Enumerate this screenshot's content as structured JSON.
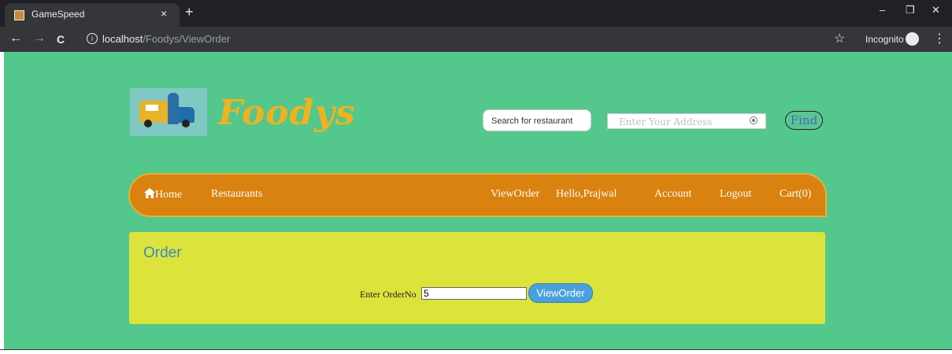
{
  "browser": {
    "tab_title": "GameSpeed",
    "tab_close": "×",
    "new_tab": "+",
    "url_host": "localhost",
    "url_path": "/Foodys/ViewOrder",
    "incognito_label": "Incognito",
    "minimize": "–",
    "restore": "❐",
    "close": "✕",
    "back": "←",
    "forward": "→",
    "reload": "C",
    "star": "☆",
    "menu": "⋮"
  },
  "header": {
    "brand": "Foodys",
    "search_placeholder": "Search for restaurant",
    "address_placeholder": "Enter Your Address",
    "find_label": "Find"
  },
  "nav": {
    "home": "Home",
    "restaurants": "Restaurants",
    "view_order": "ViewOrder",
    "greeting": "Hello,Prajwal",
    "account": "Account",
    "logout": "Logout",
    "cart": "Cart(0)"
  },
  "order": {
    "title": "Order",
    "label": "Enter OrderNo",
    "value": "5",
    "button": "ViewOrder"
  },
  "colors": {
    "page_bg": "#53c78c",
    "nav_bg": "#d9820f",
    "brand": "#f0b21e",
    "panel_bg": "#dce33b",
    "button": "#4aa0dd"
  }
}
